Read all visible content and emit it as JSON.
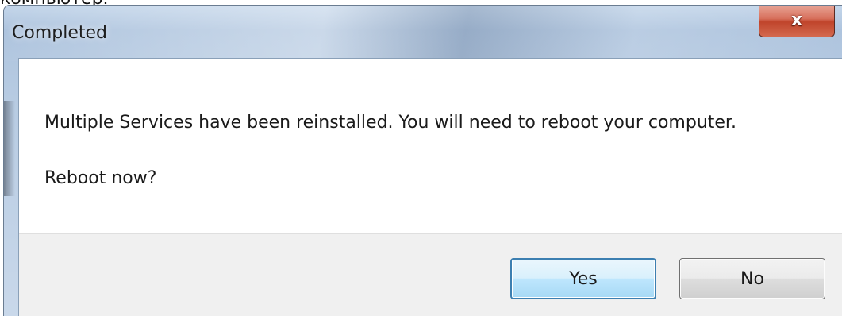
{
  "background_text": "компьютер.",
  "window": {
    "title": "Completed",
    "close_glyph": "x",
    "close_icon": "close-icon",
    "accent_color": "#c0442b"
  },
  "dialog": {
    "message": "Multiple Services have been reinstalled.  You will need to reboot your computer.",
    "question": "Reboot now?"
  },
  "buttons": {
    "yes_label": "Yes",
    "no_label": "No",
    "default_border_color": "#3c7fb1"
  }
}
